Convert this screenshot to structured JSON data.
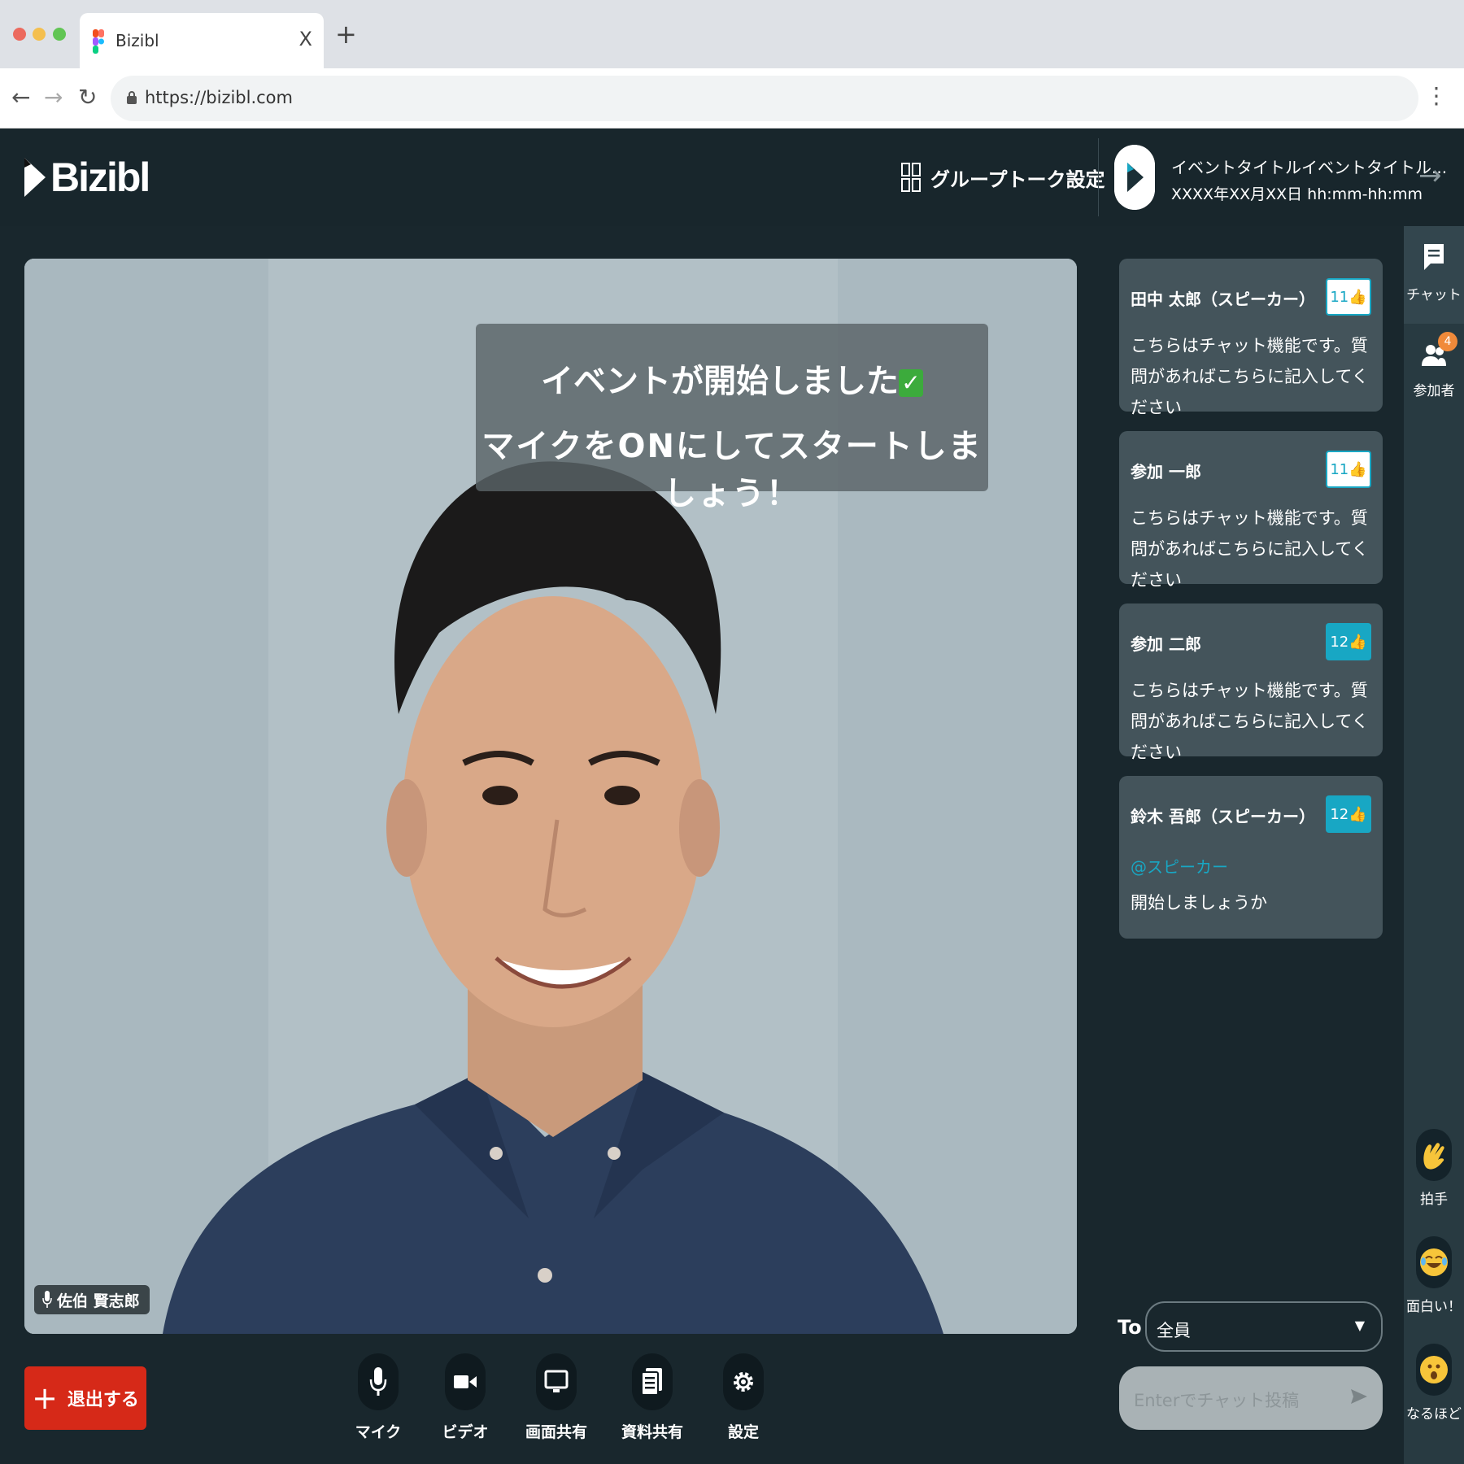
{
  "browser": {
    "tab_title": "Bizibl",
    "tab_close": "X",
    "new_tab": "+",
    "url": "https://bizibl.com"
  },
  "header": {
    "logo_text": "Bizibl",
    "group_talk_label": "グループトーク設定",
    "event_title": "イベントタイトルイベントタイトル...",
    "event_time": "XXXX年XX月XX日 hh:mm-hh:mm"
  },
  "video": {
    "banner_line1": "イベントが開始しました",
    "banner_line2": "マイクをONにしてスタートしましょう！",
    "check_mark": "✓",
    "speaker_name": "佐伯 賢志郎"
  },
  "controls": {
    "leave_label": "退出する",
    "mic_label": "マイク",
    "video_label": "ビデオ",
    "screen_share_label": "画面共有",
    "doc_share_label": "資料共有",
    "settings_label": "設定"
  },
  "chat": {
    "messages": [
      {
        "author": "田中 太郎（スピーカー）",
        "likes": "11",
        "text": "こちらはチャット機能です。質問があればこちらに記入してください"
      },
      {
        "author": "参加 一郎",
        "likes": "11",
        "text": "こちらはチャット機能です。質問があればこちらに記入してください"
      },
      {
        "author": "参加 二郎",
        "likes": "12",
        "text": "こちらはチャット機能です。質問があればこちらに記入してください"
      },
      {
        "author": "鈴木 吾郎（スピーカー）",
        "likes": "12",
        "mention": "@スピーカー",
        "text": "開始しましょうか"
      }
    ],
    "to_label": "To",
    "to_value": "全員",
    "input_placeholder": "Enterでチャット投稿"
  },
  "rail": {
    "chat_label": "チャット",
    "participants_label": "参加者",
    "participants_badge": "4",
    "clap_label": "拍手",
    "funny_label": "面白い！",
    "naruhodo_label": "なるほど"
  },
  "colors": {
    "accent": "#18a7c4",
    "leave": "#d62918",
    "background": "#19272d"
  }
}
